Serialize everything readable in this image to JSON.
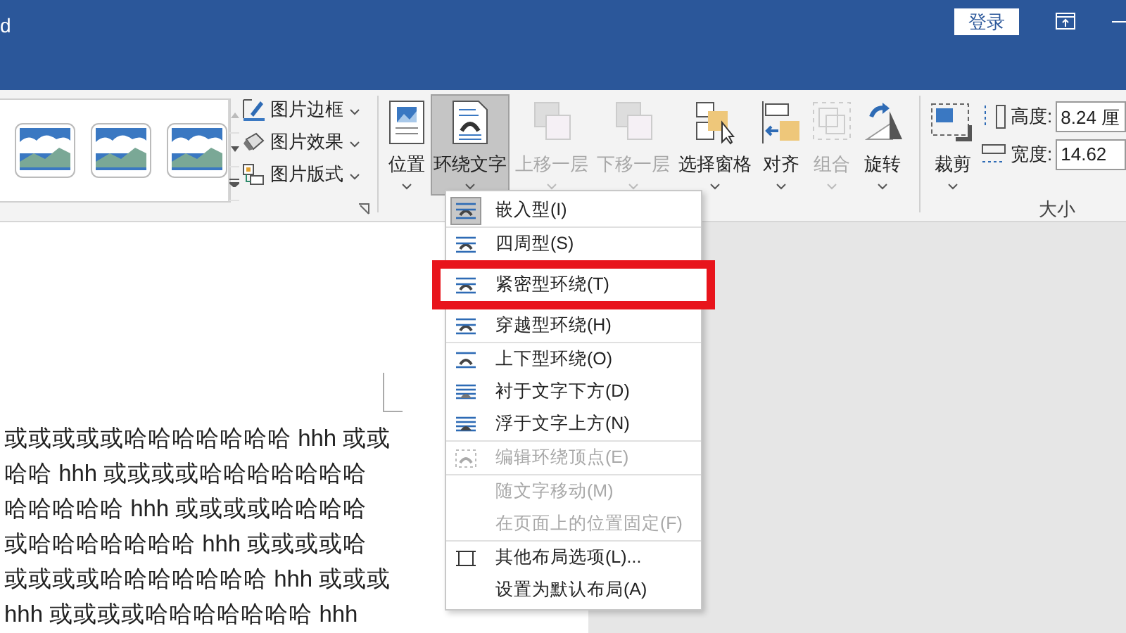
{
  "title_bar": {
    "title": "d",
    "login_button": "登录"
  },
  "ribbon": {
    "picture_tools": [
      {
        "label": "图片边框",
        "kind": "border"
      },
      {
        "label": "图片效果",
        "kind": "effect"
      },
      {
        "label": "图片版式",
        "kind": "layout"
      }
    ],
    "big_buttons": [
      {
        "label": "位置",
        "kind": "position",
        "disabled": false,
        "selected": false
      },
      {
        "label": "环绕文字",
        "kind": "wrap",
        "disabled": false,
        "selected": true
      },
      {
        "label": "上移一层",
        "kind": "forward",
        "disabled": true,
        "selected": false
      },
      {
        "label": "下移一层",
        "kind": "backward",
        "disabled": true,
        "selected": false
      },
      {
        "label": "选择窗格",
        "kind": "pane",
        "disabled": false,
        "selected": false
      },
      {
        "label": "对齐",
        "kind": "align",
        "disabled": false,
        "selected": false
      },
      {
        "label": "组合",
        "kind": "group",
        "disabled": true,
        "selected": false
      },
      {
        "label": "旋转",
        "kind": "rotate",
        "disabled": false,
        "selected": false
      }
    ],
    "size_group": {
      "crop_button": "裁剪",
      "height_label": "高度:",
      "height_value": "8.24 厘",
      "width_label": "宽度:",
      "width_value": "14.62",
      "group_label": "大小"
    }
  },
  "wrap_menu": [
    {
      "label": "嵌入型(I)",
      "kind": "inline",
      "disabled": false,
      "selected": true,
      "highlighted": false
    },
    {
      "label": "四周型(S)",
      "kind": "square",
      "disabled": false,
      "selected": false,
      "highlighted": false
    },
    {
      "label": "紧密型环绕(T)",
      "kind": "tight",
      "disabled": false,
      "selected": false,
      "highlighted": true
    },
    {
      "label": "穿越型环绕(H)",
      "kind": "through",
      "disabled": false,
      "selected": false,
      "highlighted": false
    },
    {
      "label": "上下型环绕(O)",
      "kind": "topbottom",
      "disabled": false,
      "selected": false,
      "highlighted": false
    },
    {
      "label": "衬于文字下方(D)",
      "kind": "behind",
      "disabled": false,
      "selected": false,
      "highlighted": false
    },
    {
      "label": "浮于文字上方(N)",
      "kind": "front",
      "disabled": false,
      "selected": false,
      "highlighted": false
    },
    {
      "label": "编辑环绕顶点(E)",
      "kind": "edit",
      "disabled": true,
      "selected": false,
      "highlighted": false
    },
    {
      "label": "随文字移动(M)",
      "kind": "none",
      "disabled": true,
      "selected": false,
      "highlighted": false
    },
    {
      "label": "在页面上的位置固定(F)",
      "kind": "none",
      "disabled": true,
      "selected": false,
      "highlighted": false
    },
    {
      "label": "其他布局选项(L)...",
      "kind": "more",
      "disabled": false,
      "selected": false,
      "highlighted": false
    },
    {
      "label": "设置为默认布局(A)",
      "kind": "none",
      "disabled": false,
      "selected": false,
      "highlighted": false
    }
  ],
  "document_lines": [
    "或或或或或哈哈哈哈哈哈哈 hhh 或或",
    "哈哈 hhh 或或或或哈哈哈哈哈哈哈",
    "哈哈哈哈哈 hhh 或或或或哈哈哈哈",
    "或哈哈哈哈哈哈哈 hhh 或或或或哈",
    "或或或或哈哈哈哈哈哈哈 hhh 或或或",
    "hhh 或或或或哈哈哈哈哈哈哈 hhh"
  ]
}
